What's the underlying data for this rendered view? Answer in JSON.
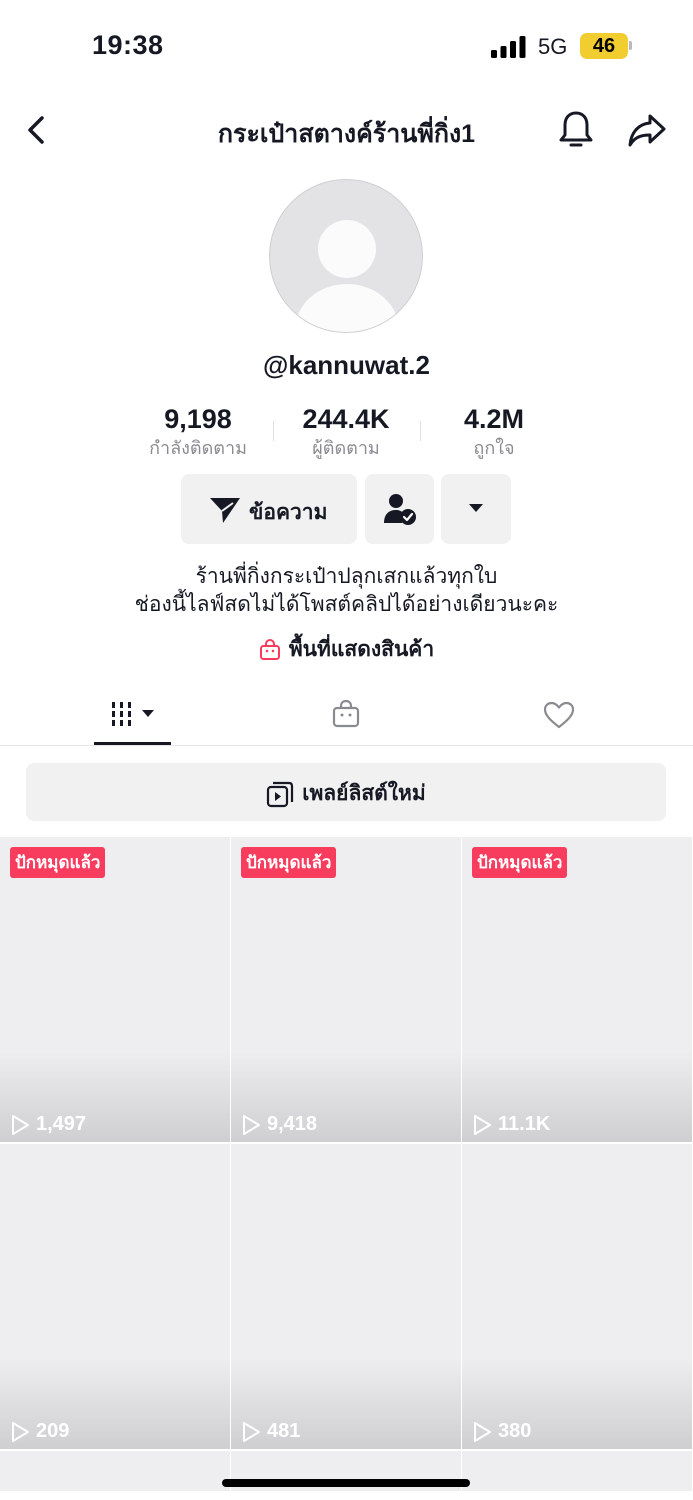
{
  "status_bar": {
    "time": "19:38",
    "network": "5G",
    "battery": "46"
  },
  "nav": {
    "title": "กระเป๋าสตางค์ร้านพี่กิ่ง1",
    "back_icon": "chevron-left-icon",
    "bell_icon": "bell-icon",
    "share_icon": "share-arrow-icon"
  },
  "profile": {
    "username": "@kannuwat.2",
    "stats": [
      {
        "value": "9,198",
        "label": "กำลังติดตาม"
      },
      {
        "value": "244.4K",
        "label": "ผู้ติดตาม"
      },
      {
        "value": "4.2M",
        "label": "ถูกใจ"
      }
    ],
    "message_label": "ข้อความ",
    "bio_line1": "ร้านพี่กิ่งกระเป๋าปลุกเสกแล้วทุกใบ",
    "bio_line2": "ช่องนี้ไลฟ์สดไม่ได้โพสต์คลิปได้อย่างเดียวนะคะ",
    "shop_link": "พื้นที่แสดงสินค้า"
  },
  "playlist": {
    "label": "เพลย์ลิสต์ใหม่"
  },
  "videos": [
    {
      "badge": "ปักหมุดแล้ว",
      "views": "1,497"
    },
    {
      "badge": "ปักหมุดแล้ว",
      "views": "9,418"
    },
    {
      "badge": "ปักหมุดแล้ว",
      "views": "11.1K"
    },
    {
      "badge": "",
      "views": "209"
    },
    {
      "badge": "",
      "views": "481"
    },
    {
      "badge": "",
      "views": "380"
    }
  ],
  "colors": {
    "accent": "#f73c5e",
    "battery": "#f2cd2f",
    "muted_text": "#8a8b91"
  }
}
